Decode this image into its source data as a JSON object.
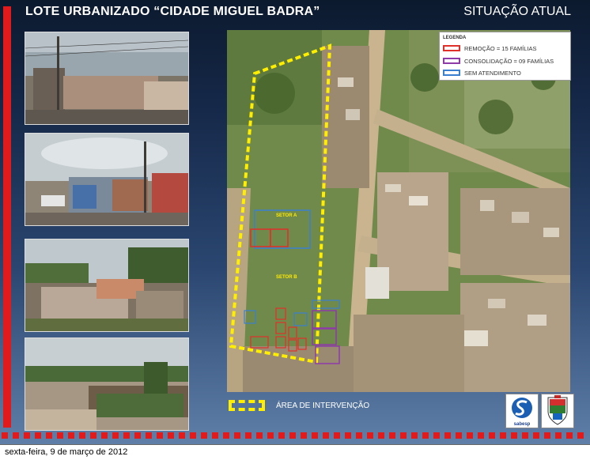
{
  "header": {
    "title": "LOTE URBANIZADO  “CIDADE MIGUEL BADRA”",
    "subtitle": "SITUAÇÃO ATUAL"
  },
  "photos": [
    {
      "icon": "street-photo-1"
    },
    {
      "icon": "street-photo-2"
    },
    {
      "icon": "street-photo-3"
    },
    {
      "icon": "street-photo-4"
    }
  ],
  "legend": {
    "title": "LEGENDA",
    "items": [
      {
        "label": "REMOÇÃO = 15 FAMÍLIAS",
        "color": "#e0302a"
      },
      {
        "label": "CONSOLIDAÇÃO = 09 FAMÍLIAS",
        "color": "#8e3aa8"
      },
      {
        "label": "SEM ATENDIMENTO",
        "color": "#3a7fd0"
      }
    ]
  },
  "map": {
    "labels": {
      "label_a": "SETOR A",
      "label_b": "SETOR B"
    }
  },
  "bottom_legend": {
    "label": "ÁREA DE INTERVENÇÃO",
    "color": "#ffee00"
  },
  "logos": {
    "sabesp_caption": "sabesp"
  },
  "footer": {
    "date": "sexta-feira, 9 de março de 2012"
  },
  "colors": {
    "accent_red": "#e11b1b",
    "background_top": "#0c1a2e",
    "background_bottom": "#5f7fa8"
  }
}
